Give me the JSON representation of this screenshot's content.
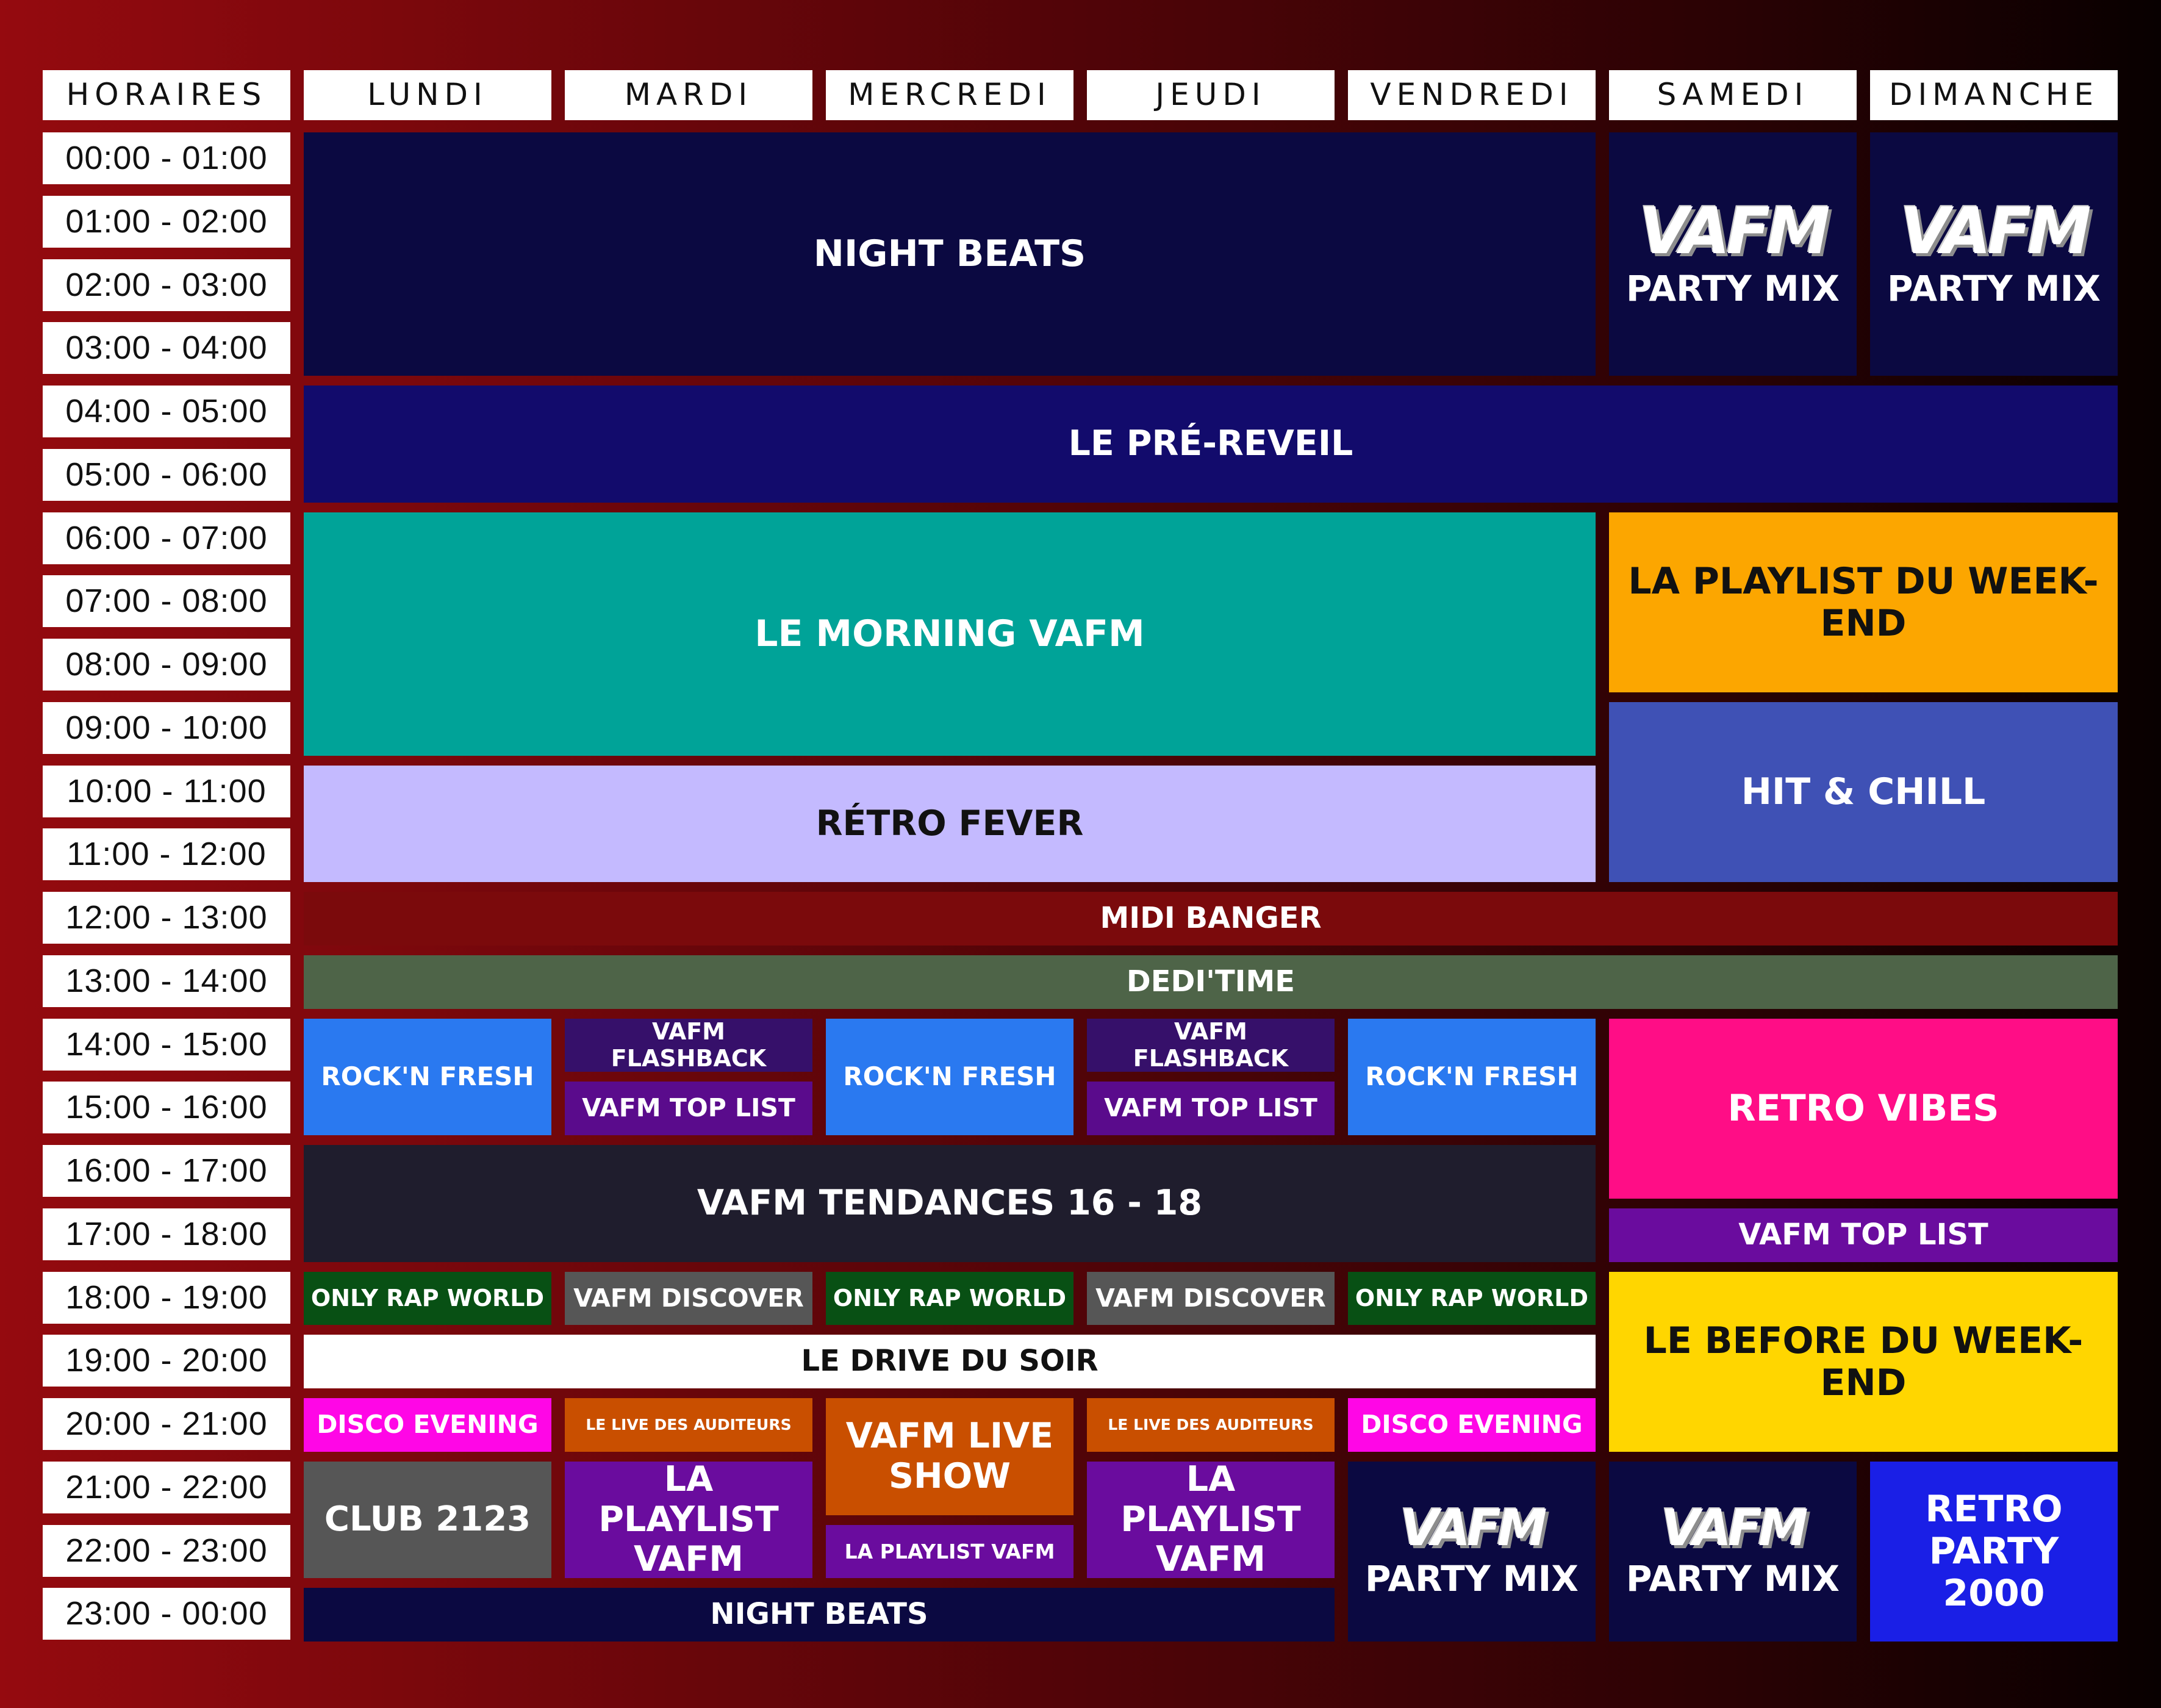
{
  "colors": {
    "navy_dark": "#0b0941",
    "navy": "#120b6c",
    "teal": "#00a398",
    "lavender": "#c4baff",
    "orange": "#fca600",
    "steel_blue": "#3f51b5",
    "dark_red": "#7b0a0c",
    "olive_green": "#4e6448",
    "sky_blue": "#2a79f0",
    "deep_purple": "#36106a",
    "purple": "#5a0b8c",
    "charcoal": "#1f1d2d",
    "hot_pink": "#ff0d86",
    "violet": "#6a0c9e",
    "forest_green": "#085014",
    "grey": "#565656",
    "white": "#ffffff",
    "magenta": "#ff06e6",
    "burnt_orange": "#c94f00",
    "yellow": "#ffd600",
    "bright_blue": "#1a1fe6"
  },
  "header": {
    "times_label": "HORAIRES",
    "days": [
      "LUNDI",
      "MARDI",
      "MERCREDI",
      "JEUDI",
      "VENDREDI",
      "SAMEDI",
      "DIMANCHE"
    ]
  },
  "times": [
    "00:00 - 01:00",
    "01:00 - 02:00",
    "02:00 - 03:00",
    "03:00 - 04:00",
    "04:00 - 05:00",
    "05:00 - 06:00",
    "06:00 - 07:00",
    "07:00 - 08:00",
    "08:00 - 09:00",
    "09:00 - 10:00",
    "10:00 - 11:00",
    "11:00 - 12:00",
    "12:00 - 13:00",
    "13:00 - 14:00",
    "14:00 - 15:00",
    "15:00 - 16:00",
    "16:00 - 17:00",
    "17:00 - 18:00",
    "18:00 - 19:00",
    "19:00 - 20:00",
    "20:00 - 21:00",
    "21:00 - 22:00",
    "22:00 - 23:00",
    "23:00 - 00:00"
  ],
  "logo_text": "VAFM",
  "programs": [
    {
      "title": "NIGHT BEATS",
      "start": 0,
      "end": 4,
      "day_start": 0,
      "day_end": 5,
      "color": "navy_dark",
      "text_color": "white"
    },
    {
      "title": "PARTY MIX",
      "start": 0,
      "end": 4,
      "day_start": 5,
      "day_end": 6,
      "color": "navy_dark",
      "text_color": "white",
      "logo": true
    },
    {
      "title": "PARTY MIX",
      "start": 0,
      "end": 4,
      "day_start": 6,
      "day_end": 7,
      "color": "navy_dark",
      "text_color": "white",
      "logo": true
    },
    {
      "title": "LE PRÉ-REVEIL",
      "start": 4,
      "end": 6,
      "day_start": 0,
      "day_end": 7,
      "color": "navy",
      "text_color": "white"
    },
    {
      "title": "LE MORNING VAFM",
      "start": 6,
      "end": 10,
      "day_start": 0,
      "day_end": 5,
      "color": "teal",
      "text_color": "white"
    },
    {
      "title": "LA PLAYLIST DU WEEK-END",
      "start": 6,
      "end": 9,
      "day_start": 5,
      "day_end": 7,
      "color": "orange",
      "text_color": "dark"
    },
    {
      "title": "RÉTRO FEVER",
      "start": 10,
      "end": 12,
      "day_start": 0,
      "day_end": 5,
      "color": "lavender",
      "text_color": "dark"
    },
    {
      "title": "HIT & CHILL",
      "start": 9,
      "end": 12,
      "day_start": 5,
      "day_end": 7,
      "color": "steel_blue",
      "text_color": "white"
    },
    {
      "title": "MIDI BANGER",
      "start": 12,
      "end": 13,
      "day_start": 0,
      "day_end": 7,
      "color": "dark_red",
      "text_color": "white"
    },
    {
      "title": "DEDI'TIME",
      "start": 13,
      "end": 14,
      "day_start": 0,
      "day_end": 7,
      "color": "olive_green",
      "text_color": "white"
    },
    {
      "title": "ROCK'N FRESH",
      "start": 14,
      "end": 16,
      "day_start": 0,
      "day_end": 1,
      "color": "sky_blue",
      "text_color": "white"
    },
    {
      "title": "VAFM FLASHBACK",
      "start": 14,
      "end": 15,
      "day_start": 1,
      "day_end": 2,
      "color": "deep_purple",
      "text_color": "white"
    },
    {
      "title": "VAFM TOP LIST",
      "start": 15,
      "end": 16,
      "day_start": 1,
      "day_end": 2,
      "color": "purple",
      "text_color": "white"
    },
    {
      "title": "ROCK'N FRESH",
      "start": 14,
      "end": 16,
      "day_start": 2,
      "day_end": 3,
      "color": "sky_blue",
      "text_color": "white"
    },
    {
      "title": "VAFM FLASHBACK",
      "start": 14,
      "end": 15,
      "day_start": 3,
      "day_end": 4,
      "color": "deep_purple",
      "text_color": "white"
    },
    {
      "title": "VAFM TOP LIST",
      "start": 15,
      "end": 16,
      "day_start": 3,
      "day_end": 4,
      "color": "purple",
      "text_color": "white"
    },
    {
      "title": "ROCK'N FRESH",
      "start": 14,
      "end": 16,
      "day_start": 4,
      "day_end": 5,
      "color": "sky_blue",
      "text_color": "white"
    },
    {
      "title": "RETRO VIBES",
      "start": 14,
      "end": 17,
      "day_start": 5,
      "day_end": 7,
      "color": "hot_pink",
      "text_color": "white"
    },
    {
      "title": "VAFM TENDANCES 16 - 18",
      "start": 16,
      "end": 18,
      "day_start": 0,
      "day_end": 5,
      "color": "charcoal",
      "text_color": "white"
    },
    {
      "title": "VAFM TOP LIST",
      "start": 17,
      "end": 18,
      "day_start": 5,
      "day_end": 7,
      "color": "violet",
      "text_color": "white"
    },
    {
      "title": "ONLY RAP WORLD",
      "start": 18,
      "end": 19,
      "day_start": 0,
      "day_end": 1,
      "color": "forest_green",
      "text_color": "white"
    },
    {
      "title": "VAFM DISCOVER",
      "start": 18,
      "end": 19,
      "day_start": 1,
      "day_end": 2,
      "color": "grey",
      "text_color": "white"
    },
    {
      "title": "ONLY RAP WORLD",
      "start": 18,
      "end": 19,
      "day_start": 2,
      "day_end": 3,
      "color": "forest_green",
      "text_color": "white"
    },
    {
      "title": "VAFM DISCOVER",
      "start": 18,
      "end": 19,
      "day_start": 3,
      "day_end": 4,
      "color": "grey",
      "text_color": "white"
    },
    {
      "title": "ONLY RAP WORLD",
      "start": 18,
      "end": 19,
      "day_start": 4,
      "day_end": 5,
      "color": "forest_green",
      "text_color": "white"
    },
    {
      "title": "LE BEFORE DU WEEK-END",
      "start": 18,
      "end": 21,
      "day_start": 5,
      "day_end": 7,
      "color": "yellow",
      "text_color": "dark"
    },
    {
      "title": "LE DRIVE DU SOIR",
      "start": 19,
      "end": 20,
      "day_start": 0,
      "day_end": 5,
      "color": "white",
      "text_color": "dark"
    },
    {
      "title": "DISCO EVENING",
      "start": 20,
      "end": 21,
      "day_start": 0,
      "day_end": 1,
      "color": "magenta",
      "text_color": "white"
    },
    {
      "title": "LE LIVE DES AUDITEURS",
      "start": 20,
      "end": 21,
      "day_start": 1,
      "day_end": 2,
      "color": "burnt_orange",
      "text_color": "white"
    },
    {
      "title": "VAFM LIVE SHOW",
      "start": 20,
      "end": 22,
      "day_start": 2,
      "day_end": 3,
      "color": "burnt_orange",
      "text_color": "white"
    },
    {
      "title": "LE LIVE DES AUDITEURS",
      "start": 20,
      "end": 21,
      "day_start": 3,
      "day_end": 4,
      "color": "burnt_orange",
      "text_color": "white"
    },
    {
      "title": "DISCO EVENING",
      "start": 20,
      "end": 21,
      "day_start": 4,
      "day_end": 5,
      "color": "magenta",
      "text_color": "white"
    },
    {
      "title": "CLUB 2123",
      "start": 21,
      "end": 23,
      "day_start": 0,
      "day_end": 1,
      "color": "grey",
      "text_color": "white"
    },
    {
      "title": "LA PLAYLIST VAFM",
      "start": 21,
      "end": 23,
      "day_start": 1,
      "day_end": 2,
      "color": "violet",
      "text_color": "white"
    },
    {
      "title": "LA PLAYLIST VAFM",
      "start": 22,
      "end": 23,
      "day_start": 2,
      "day_end": 3,
      "color": "violet",
      "text_color": "white"
    },
    {
      "title": "LA PLAYLIST VAFM",
      "start": 21,
      "end": 23,
      "day_start": 3,
      "day_end": 4,
      "color": "violet",
      "text_color": "white"
    },
    {
      "title": "PARTY MIX",
      "start": 21,
      "end": 24,
      "day_start": 4,
      "day_end": 5,
      "color": "navy_dark",
      "text_color": "white",
      "logo": true
    },
    {
      "title": "PARTY MIX",
      "start": 21,
      "end": 24,
      "day_start": 5,
      "day_end": 6,
      "color": "navy_dark",
      "text_color": "white",
      "logo": true
    },
    {
      "title": "RETRO PARTY 2000",
      "start": 21,
      "end": 24,
      "day_start": 6,
      "day_end": 7,
      "color": "bright_blue",
      "text_color": "white"
    },
    {
      "title": "NIGHT BEATS",
      "start": 23,
      "end": 24,
      "day_start": 0,
      "day_end": 4,
      "color": "navy_dark",
      "text_color": "white"
    }
  ]
}
